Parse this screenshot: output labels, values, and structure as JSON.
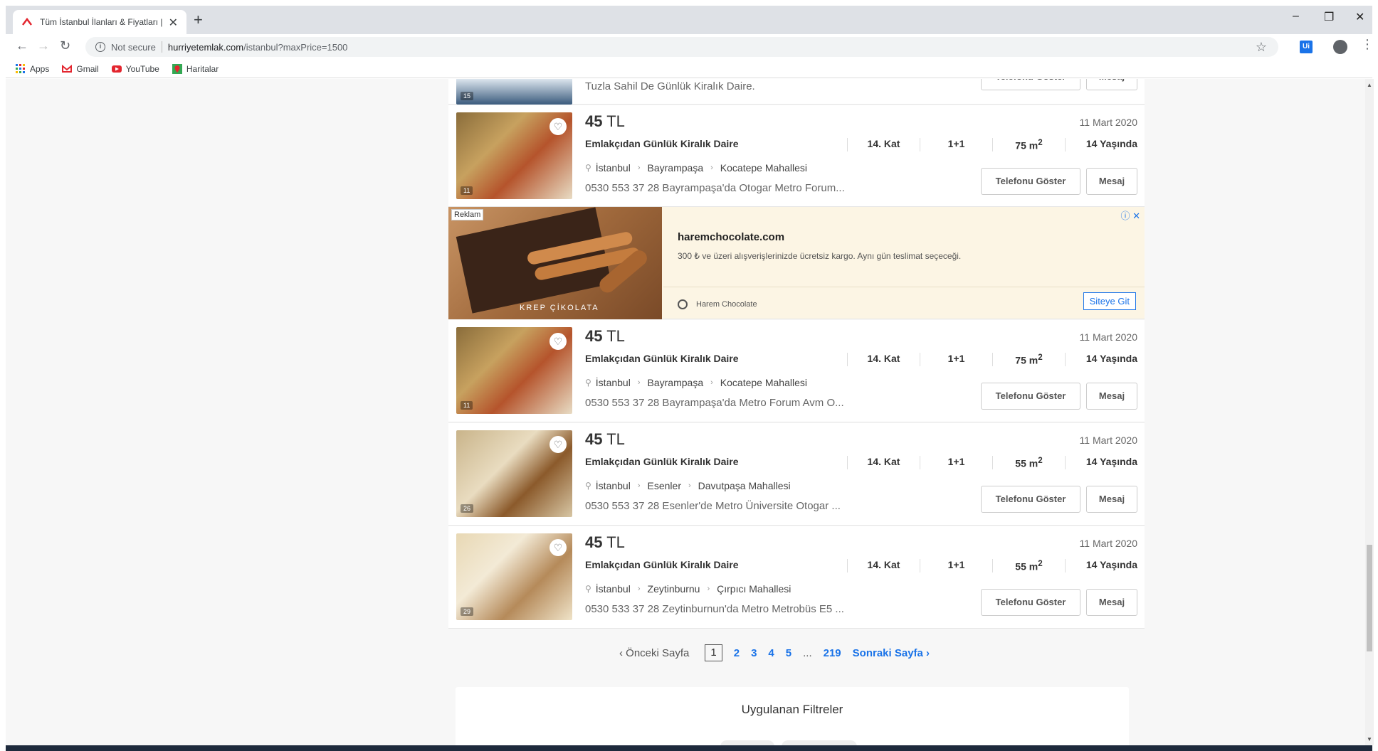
{
  "browser": {
    "tab_title": "Tüm İstanbul İlanları & Fiyatları |",
    "tab_close": "✕",
    "new_tab": "+",
    "win_min": "–",
    "win_max": "❐",
    "win_close": "✕",
    "not_secure": "Not secure",
    "url_host": "hurriyetemlak.com",
    "url_path": "/istanbul?maxPrice=1500",
    "ext_label": "Ui",
    "bookmarks": [
      "Apps",
      "Gmail",
      "YouTube",
      "Haritalar"
    ]
  },
  "top_partial": {
    "desc": "Tuzla Sahil De Günlük Kiralık Daire.",
    "count": "15",
    "phone_btn": "Telefonu Göster",
    "msg_btn": "Mesaj"
  },
  "listings": [
    {
      "price": "45",
      "currency": "TL",
      "date": "11 Mart 2020",
      "title": "Emlakçıdan Günlük Kiralık Daire",
      "floor": "14. Kat",
      "rooms": "1+1",
      "area": "75 m",
      "age": "14 Yaşında",
      "city": "İstanbul",
      "district": "Bayrampaşa",
      "neighborhood": "Kocatepe Mahallesi",
      "desc": "0530 553 37 28 Bayrampaşa'da Otogar Metro Forum...",
      "photos": "11",
      "phone_btn": "Telefonu Göster",
      "msg_btn": "Mesaj"
    },
    {
      "price": "45",
      "currency": "TL",
      "date": "11 Mart 2020",
      "title": "Emlakçıdan Günlük Kiralık Daire",
      "floor": "14. Kat",
      "rooms": "1+1",
      "area": "75 m",
      "age": "14 Yaşında",
      "city": "İstanbul",
      "district": "Bayrampaşa",
      "neighborhood": "Kocatepe Mahallesi",
      "desc": "0530 553 37 28 Bayrampaşa'da Metro Forum Avm O...",
      "photos": "11",
      "phone_btn": "Telefonu Göster",
      "msg_btn": "Mesaj"
    },
    {
      "price": "45",
      "currency": "TL",
      "date": "11 Mart 2020",
      "title": "Emlakçıdan Günlük Kiralık Daire",
      "floor": "14. Kat",
      "rooms": "1+1",
      "area": "55 m",
      "age": "14 Yaşında",
      "city": "İstanbul",
      "district": "Esenler",
      "neighborhood": "Davutpaşa Mahallesi",
      "desc": "0530 553 37 28 Esenler'de Metro Üniversite Otogar ...",
      "photos": "26",
      "phone_btn": "Telefonu Göster",
      "msg_btn": "Mesaj"
    },
    {
      "price": "45",
      "currency": "TL",
      "date": "11 Mart 2020",
      "title": "Emlakçıdan Günlük Kiralık Daire",
      "floor": "14. Kat",
      "rooms": "1+1",
      "area": "55 m",
      "age": "14 Yaşında",
      "city": "İstanbul",
      "district": "Zeytinburnu",
      "neighborhood": "Çırpıcı Mahallesi",
      "desc": "0530 533 37 28 Zeytinburnun'da Metro Metrobüs E5 ...",
      "photos": "29",
      "phone_btn": "Telefonu Göster",
      "msg_btn": "Mesaj"
    }
  ],
  "area_sup": "2",
  "ad": {
    "label": "Reklam",
    "domain": "haremchocolate.com",
    "text": "300 ₺ ve üzeri alışverişlerinizde ücretsiz kargo. Aynı gün teslimat seçeceği.",
    "sponsor": "Harem Chocolate",
    "cta": "Siteye Git",
    "image_text": "KREP ÇİKOLATA",
    "info": "ⓘ ✕"
  },
  "pagination": {
    "prev": "Önceki Sayfa",
    "current": "1",
    "pages": [
      "2",
      "3",
      "4",
      "5"
    ],
    "dots": "...",
    "last": "219",
    "next": "Sonraki Sayfa"
  },
  "filters": {
    "title": "Uygulanan Filtreler"
  },
  "colors": {
    "accent": "#1a73e8",
    "brand_red": "#e3262f"
  }
}
